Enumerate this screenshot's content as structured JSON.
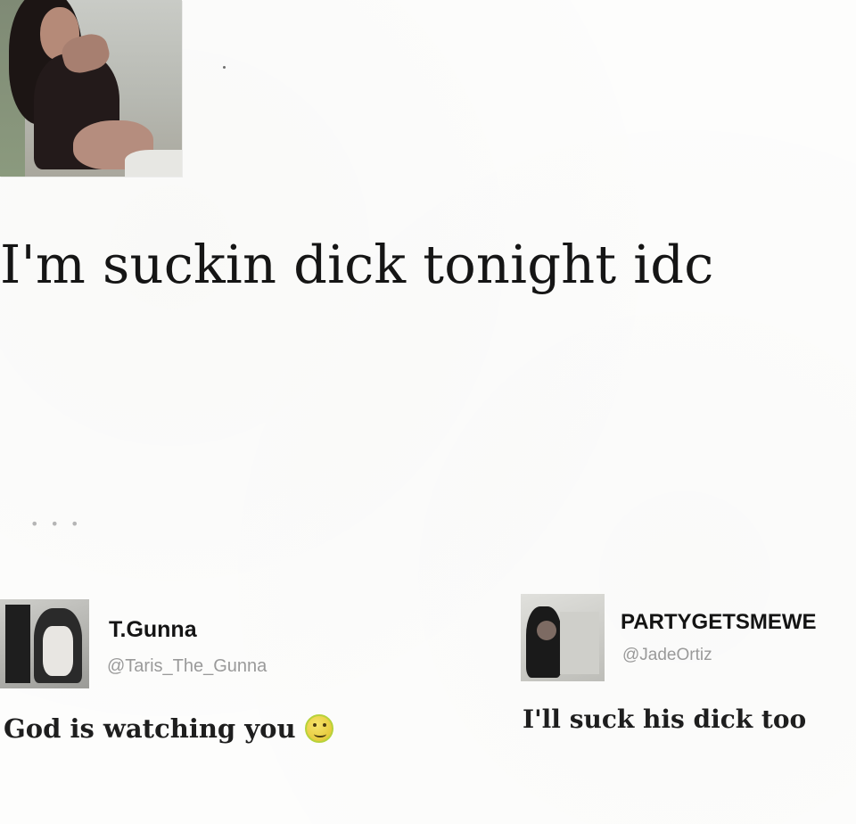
{
  "post": {
    "text": "I'm suckin dick tonight idc",
    "photo_icon": "person-photo"
  },
  "replies": [
    {
      "display_name": "T.Gunna",
      "handle": "@Taris_The_Gunna",
      "text": "God is watching you",
      "emoji": "thinking-face-icon"
    },
    {
      "display_name": "PARTYGETSMEWE",
      "handle": "@JadeOrtiz",
      "text": "I'll suck his dick too"
    }
  ],
  "colors": {
    "background": "#fdfdfc",
    "text": "#151515",
    "handle": "#9a9a9a"
  }
}
